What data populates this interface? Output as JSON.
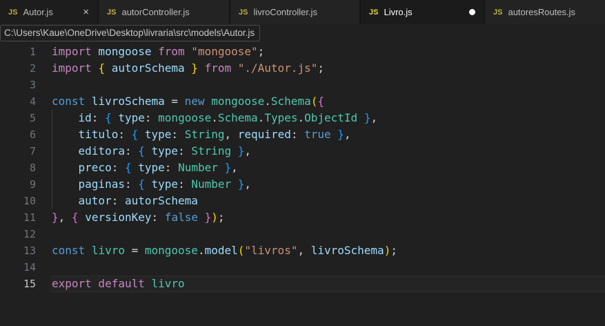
{
  "tabs": [
    {
      "label": "Autor.js",
      "icon": "js-file-icon",
      "state": "hover",
      "close_glyph": "×"
    },
    {
      "label": "autorController.js",
      "icon": "js-file-icon",
      "state": "inactive"
    },
    {
      "label": "livroController.js",
      "icon": "js-file-icon",
      "state": "inactive"
    },
    {
      "label": "Livro.js",
      "icon": "js-file-icon",
      "state": "active",
      "modified": true
    },
    {
      "label": "autoresRoutes.js",
      "icon": "js-file-icon",
      "state": "inactive"
    }
  ],
  "tooltip": {
    "text": "C:\\Users\\Kaue\\OneDrive\\Desktop\\livraria\\src\\models\\Autor.js"
  },
  "editor": {
    "language": "javascript",
    "active_line": 15,
    "colors": {
      "kw1": "#C586C0",
      "kw2": "#569CD6",
      "var": "#9CDCFE",
      "type": "#4EC9B0",
      "str": "#CE9178",
      "pun": "#D4D4D4",
      "b1": "#FFD700",
      "b2": "#DA70D6",
      "b3": "#179FFF",
      "background": "#202020",
      "tabbar_background": "#151515",
      "line_number": "#6e7681",
      "js_badge": "#e8d44d"
    },
    "lines": [
      {
        "n": 1,
        "tokens": [
          [
            "import",
            "kw1"
          ],
          [
            " mongoose",
            "var"
          ],
          [
            " from",
            "kw1"
          ],
          [
            " \"mongoose\"",
            "str"
          ],
          [
            ";",
            "pun"
          ]
        ]
      },
      {
        "n": 2,
        "tokens": [
          [
            "import",
            "kw1"
          ],
          [
            " ",
            "pun"
          ],
          [
            "{",
            "b1"
          ],
          [
            " autorSchema",
            "var"
          ],
          [
            " }",
            "b1"
          ],
          [
            " from",
            "kw1"
          ],
          [
            " \"./Autor.js\"",
            "str"
          ],
          [
            ";",
            "pun"
          ]
        ]
      },
      {
        "n": 3,
        "tokens": []
      },
      {
        "n": 4,
        "tokens": [
          [
            "const",
            "kw2"
          ],
          [
            " livroSchema",
            "var"
          ],
          [
            " =",
            "pun"
          ],
          [
            " new",
            "kw2"
          ],
          [
            " mongoose",
            "type"
          ],
          [
            ".",
            "pun"
          ],
          [
            "Schema",
            "type"
          ],
          [
            "(",
            "b1"
          ],
          [
            "{",
            "b2"
          ]
        ]
      },
      {
        "n": 5,
        "tokens": [
          [
            "    id",
            "var"
          ],
          [
            ":",
            "pun"
          ],
          [
            " ",
            "pun"
          ],
          [
            "{",
            "b3"
          ],
          [
            " type",
            "var"
          ],
          [
            ":",
            "pun"
          ],
          [
            " mongoose",
            "type"
          ],
          [
            ".",
            "pun"
          ],
          [
            "Schema",
            "type"
          ],
          [
            ".",
            "pun"
          ],
          [
            "Types",
            "type"
          ],
          [
            ".",
            "pun"
          ],
          [
            "ObjectId",
            "type"
          ],
          [
            " ",
            "pun"
          ],
          [
            "}",
            "b3"
          ],
          [
            ",",
            "pun"
          ]
        ]
      },
      {
        "n": 6,
        "tokens": [
          [
            "    titulo",
            "var"
          ],
          [
            ":",
            "pun"
          ],
          [
            " ",
            "pun"
          ],
          [
            "{",
            "b3"
          ],
          [
            " type",
            "var"
          ],
          [
            ":",
            "pun"
          ],
          [
            " String",
            "type"
          ],
          [
            ",",
            "pun"
          ],
          [
            " required",
            "var"
          ],
          [
            ":",
            "pun"
          ],
          [
            " true",
            "kw2"
          ],
          [
            " ",
            "pun"
          ],
          [
            "}",
            "b3"
          ],
          [
            ",",
            "pun"
          ]
        ]
      },
      {
        "n": 7,
        "tokens": [
          [
            "    editora",
            "var"
          ],
          [
            ":",
            "pun"
          ],
          [
            " ",
            "pun"
          ],
          [
            "{",
            "b3"
          ],
          [
            " type",
            "var"
          ],
          [
            ":",
            "pun"
          ],
          [
            " String",
            "type"
          ],
          [
            " ",
            "pun"
          ],
          [
            "}",
            "b3"
          ],
          [
            ",",
            "pun"
          ]
        ]
      },
      {
        "n": 8,
        "tokens": [
          [
            "    preco",
            "var"
          ],
          [
            ":",
            "pun"
          ],
          [
            " ",
            "pun"
          ],
          [
            "{",
            "b3"
          ],
          [
            " type",
            "var"
          ],
          [
            ":",
            "pun"
          ],
          [
            " Number",
            "type"
          ],
          [
            " ",
            "pun"
          ],
          [
            "}",
            "b3"
          ],
          [
            ",",
            "pun"
          ]
        ]
      },
      {
        "n": 9,
        "tokens": [
          [
            "    paginas",
            "var"
          ],
          [
            ":",
            "pun"
          ],
          [
            " ",
            "pun"
          ],
          [
            "{",
            "b3"
          ],
          [
            " type",
            "var"
          ],
          [
            ":",
            "pun"
          ],
          [
            " Number",
            "type"
          ],
          [
            " ",
            "pun"
          ],
          [
            "}",
            "b3"
          ],
          [
            ",",
            "pun"
          ]
        ]
      },
      {
        "n": 10,
        "tokens": [
          [
            "    autor",
            "var"
          ],
          [
            ":",
            "pun"
          ],
          [
            " autorSchema",
            "var"
          ]
        ]
      },
      {
        "n": 11,
        "tokens": [
          [
            "}",
            "b2"
          ],
          [
            ",",
            "pun"
          ],
          [
            " ",
            "pun"
          ],
          [
            "{",
            "b2"
          ],
          [
            " versionKey",
            "var"
          ],
          [
            ":",
            "pun"
          ],
          [
            " false",
            "kw2"
          ],
          [
            " ",
            "pun"
          ],
          [
            "}",
            "b2"
          ],
          [
            ")",
            "b1"
          ],
          [
            ";",
            "pun"
          ]
        ]
      },
      {
        "n": 12,
        "tokens": []
      },
      {
        "n": 13,
        "tokens": [
          [
            "const",
            "kw2"
          ],
          [
            " livro",
            "type"
          ],
          [
            " =",
            "pun"
          ],
          [
            " mongoose",
            "type"
          ],
          [
            ".",
            "pun"
          ],
          [
            "model",
            "var"
          ],
          [
            "(",
            "b1"
          ],
          [
            "\"livros\"",
            "str"
          ],
          [
            ",",
            "pun"
          ],
          [
            " livroSchema",
            "var"
          ],
          [
            ")",
            "b1"
          ],
          [
            ";",
            "pun"
          ]
        ]
      },
      {
        "n": 14,
        "tokens": []
      },
      {
        "n": 15,
        "tokens": [
          [
            "export",
            "kw1"
          ],
          [
            " default",
            "kw1"
          ],
          [
            " livro",
            "type"
          ]
        ]
      }
    ]
  }
}
